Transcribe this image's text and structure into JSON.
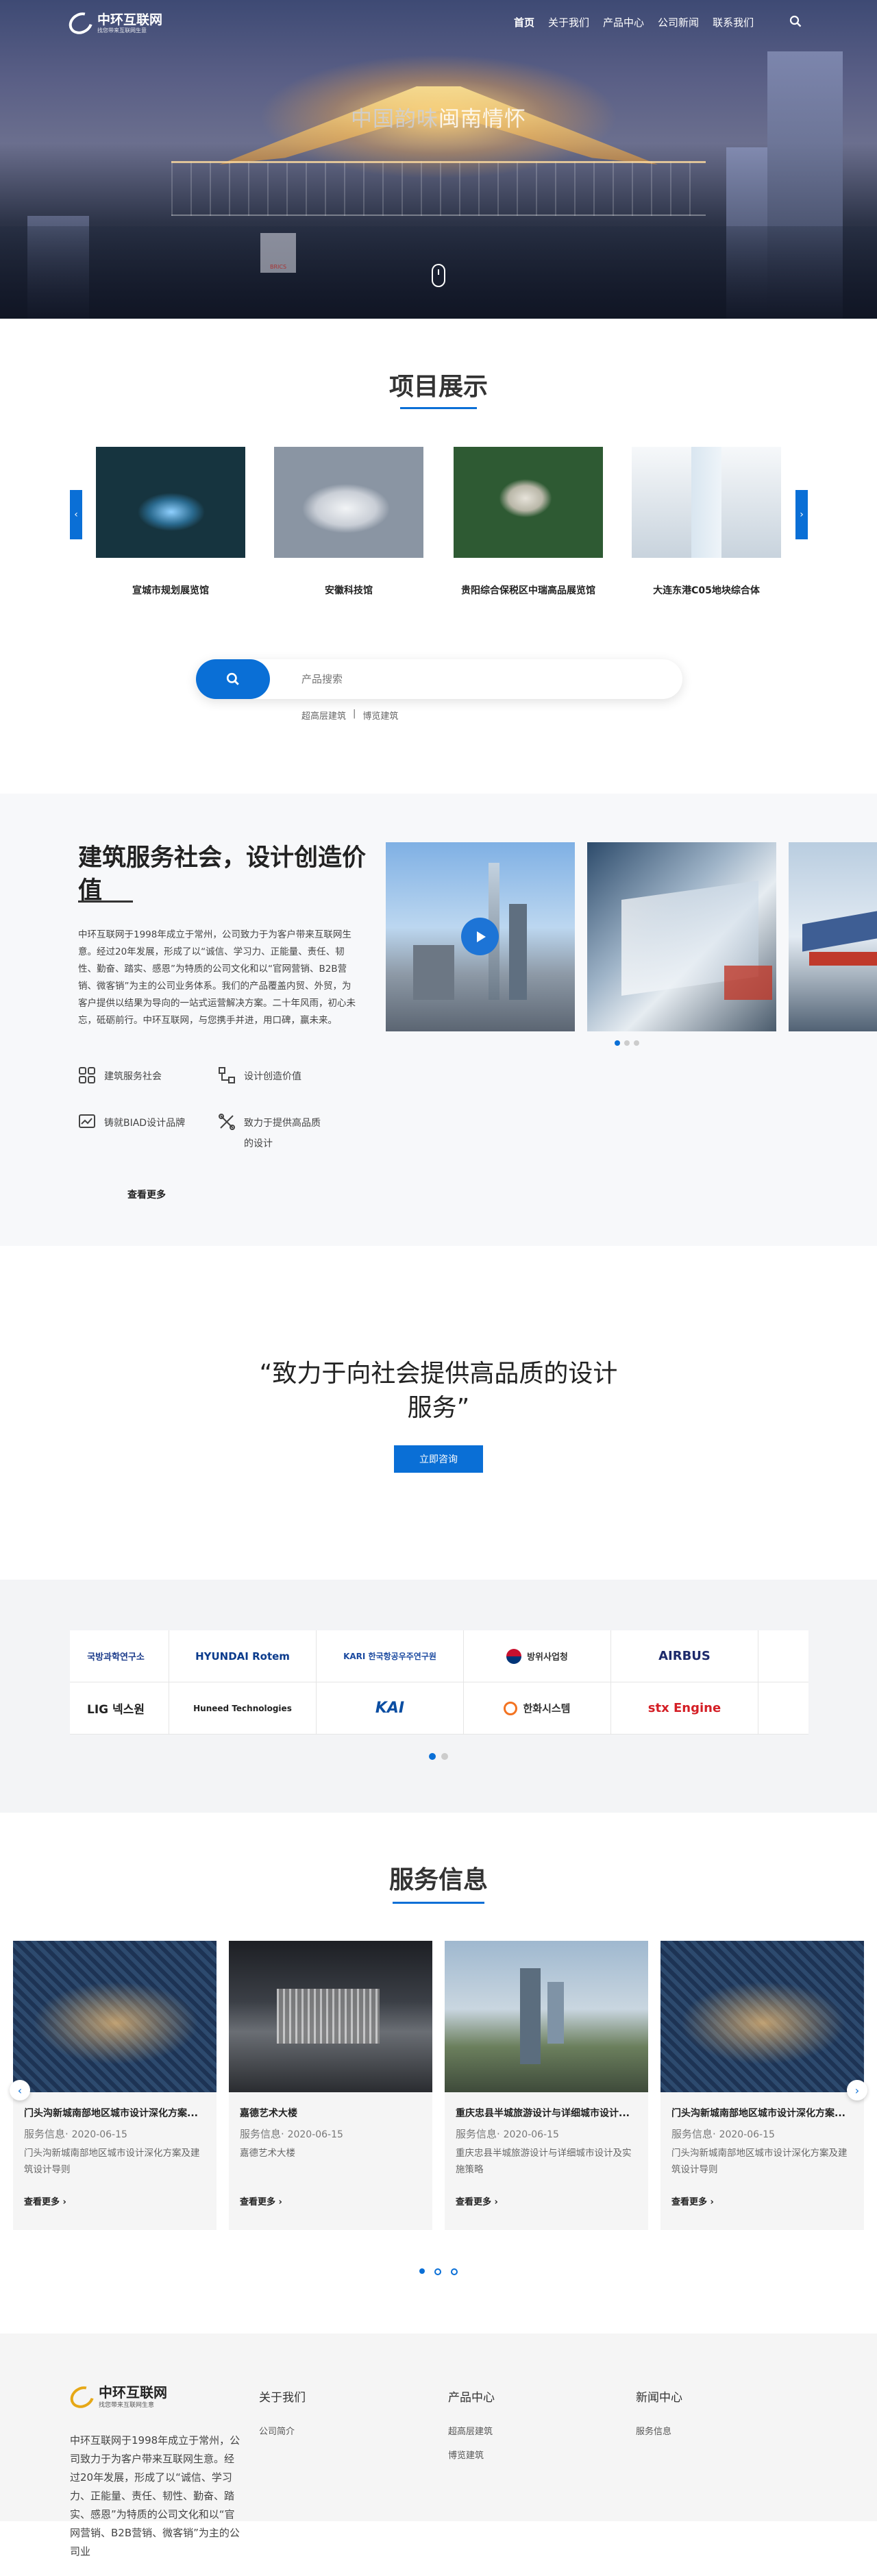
{
  "header": {
    "logo_title": "中环互联网",
    "logo_sub": "找您带来互联网生意",
    "nav": [
      {
        "label": "首页",
        "active": true
      },
      {
        "label": "关于我们"
      },
      {
        "label": "产品中心"
      },
      {
        "label": "公司新闻"
      },
      {
        "label": "联系我们"
      }
    ],
    "search_icon": "search-icon"
  },
  "hero": {
    "title_muted": "中国韵味",
    "title_main": "闽南情怀",
    "building_sign": "BRICS"
  },
  "projects": {
    "title": "项目展示",
    "prev": "‹",
    "next": "›",
    "items": [
      {
        "caption": "宣城市规划展览馆"
      },
      {
        "caption": "安徽科技馆"
      },
      {
        "caption": "贵阳综合保税区中瑞高品展览馆"
      },
      {
        "caption": "大连东港C05地块综合体"
      }
    ]
  },
  "search": {
    "placeholder": "产品搜索",
    "tags": [
      "超高层建筑",
      "|",
      "博览建筑"
    ]
  },
  "about": {
    "title": "建筑服务社会，设计创造价值",
    "body": "中环互联网于1998年成立于常州，公司致力于为客户带来互联网生意。经过20年发展，形成了以“诚信、学习力、正能量、责任、韧性、勤奋、踏实、感恩”为特质的公司文化和以“官网营销、B2B营销、微客销”为主的公司业务体系。我们的产品覆盖内贸、外贸，为客户提供以结果为导向的一站式运营解决方案。二十年风雨，初心未忘，砥砺前行。中环互联网，与您携手并进，用口碑，赢未来。",
    "features": [
      {
        "icon": "grid-icon",
        "label": "建筑服务社会"
      },
      {
        "icon": "workflow-icon",
        "label": "设计创造价值"
      },
      {
        "icon": "chart-icon",
        "label": "铸就BIAD设计品牌"
      },
      {
        "icon": "tools-icon",
        "label": "致力于提供高品质的设计"
      }
    ],
    "more": "查看更多",
    "play_icon": "play-icon"
  },
  "quote": {
    "line1": "“致力于向社会提供高品质的设计",
    "line2": "服务”",
    "button": "立即咨询"
  },
  "partners": {
    "row1": [
      {
        "name": "국방과학연구소",
        "color": "#1a3a8a"
      },
      {
        "name": "HYUNDAI Rotem",
        "color": "#0b3b8c"
      },
      {
        "name": "KARI 한국항공우주연구원",
        "color": "#1b4aa0"
      },
      {
        "name": "방위사업청",
        "color": "#333333"
      },
      {
        "name": "AIRBUS",
        "color": "#1d2a6b"
      }
    ],
    "row2": [
      {
        "name": "LIG 넥스원",
        "color": "#222222"
      },
      {
        "name": "Huneed Technologies",
        "color": "#222222"
      },
      {
        "name": "KAI",
        "color": "#0b4ea2"
      },
      {
        "name": "한화시스템",
        "color": "#333333"
      },
      {
        "name": "stx Engine",
        "color": "#d41f26"
      }
    ]
  },
  "services": {
    "title": "服务信息",
    "prev": "‹",
    "next": "›",
    "items": [
      {
        "title": "门头沟新城南部地区城市设计深化方案...",
        "category": "服务信息",
        "date": "2020-06-15",
        "desc": "门头沟新城南部地区城市设计深化方案及建筑设计导则",
        "more": "查看更多"
      },
      {
        "title": "嘉德艺术大楼",
        "category": "服务信息",
        "date": "2020-06-15",
        "desc": "嘉德艺术大楼",
        "more": "查看更多"
      },
      {
        "title": "重庆忠县半城旅游设计与详细城市设计...",
        "category": "服务信息",
        "date": "2020-06-15",
        "desc": "重庆忠县半城旅游设计与详细城市设计及实施策略",
        "more": "查看更多"
      },
      {
        "title": "门头沟新城南部地区城市设计深化方案...",
        "category": "服务信息",
        "date": "2020-06-15",
        "desc": "门头沟新城南部地区城市设计深化方案及建筑设计导则",
        "more": "查看更多"
      }
    ]
  },
  "footer": {
    "logo_title": "中环互联网",
    "logo_sub": "找您带来互联网生意",
    "about_text": "中环互联网于1998年成立于常州，公司致力于为客户带来互联网生意。经过20年发展，形成了以“诚信、学习力、正能量、责任、韧性、勤奋、踏实、感恩”为特质的公司文化和以“官网营销、B2B营销、微客销”为主的公司业",
    "columns": [
      {
        "title": "关于我们",
        "links": [
          "公司简介"
        ]
      },
      {
        "title": "产品中心",
        "links": [
          "超高层建筑",
          "博览建筑"
        ]
      },
      {
        "title": "新闻中心",
        "links": [
          "服务信息"
        ]
      }
    ]
  },
  "colors": {
    "accent": "#0a6fd6"
  }
}
